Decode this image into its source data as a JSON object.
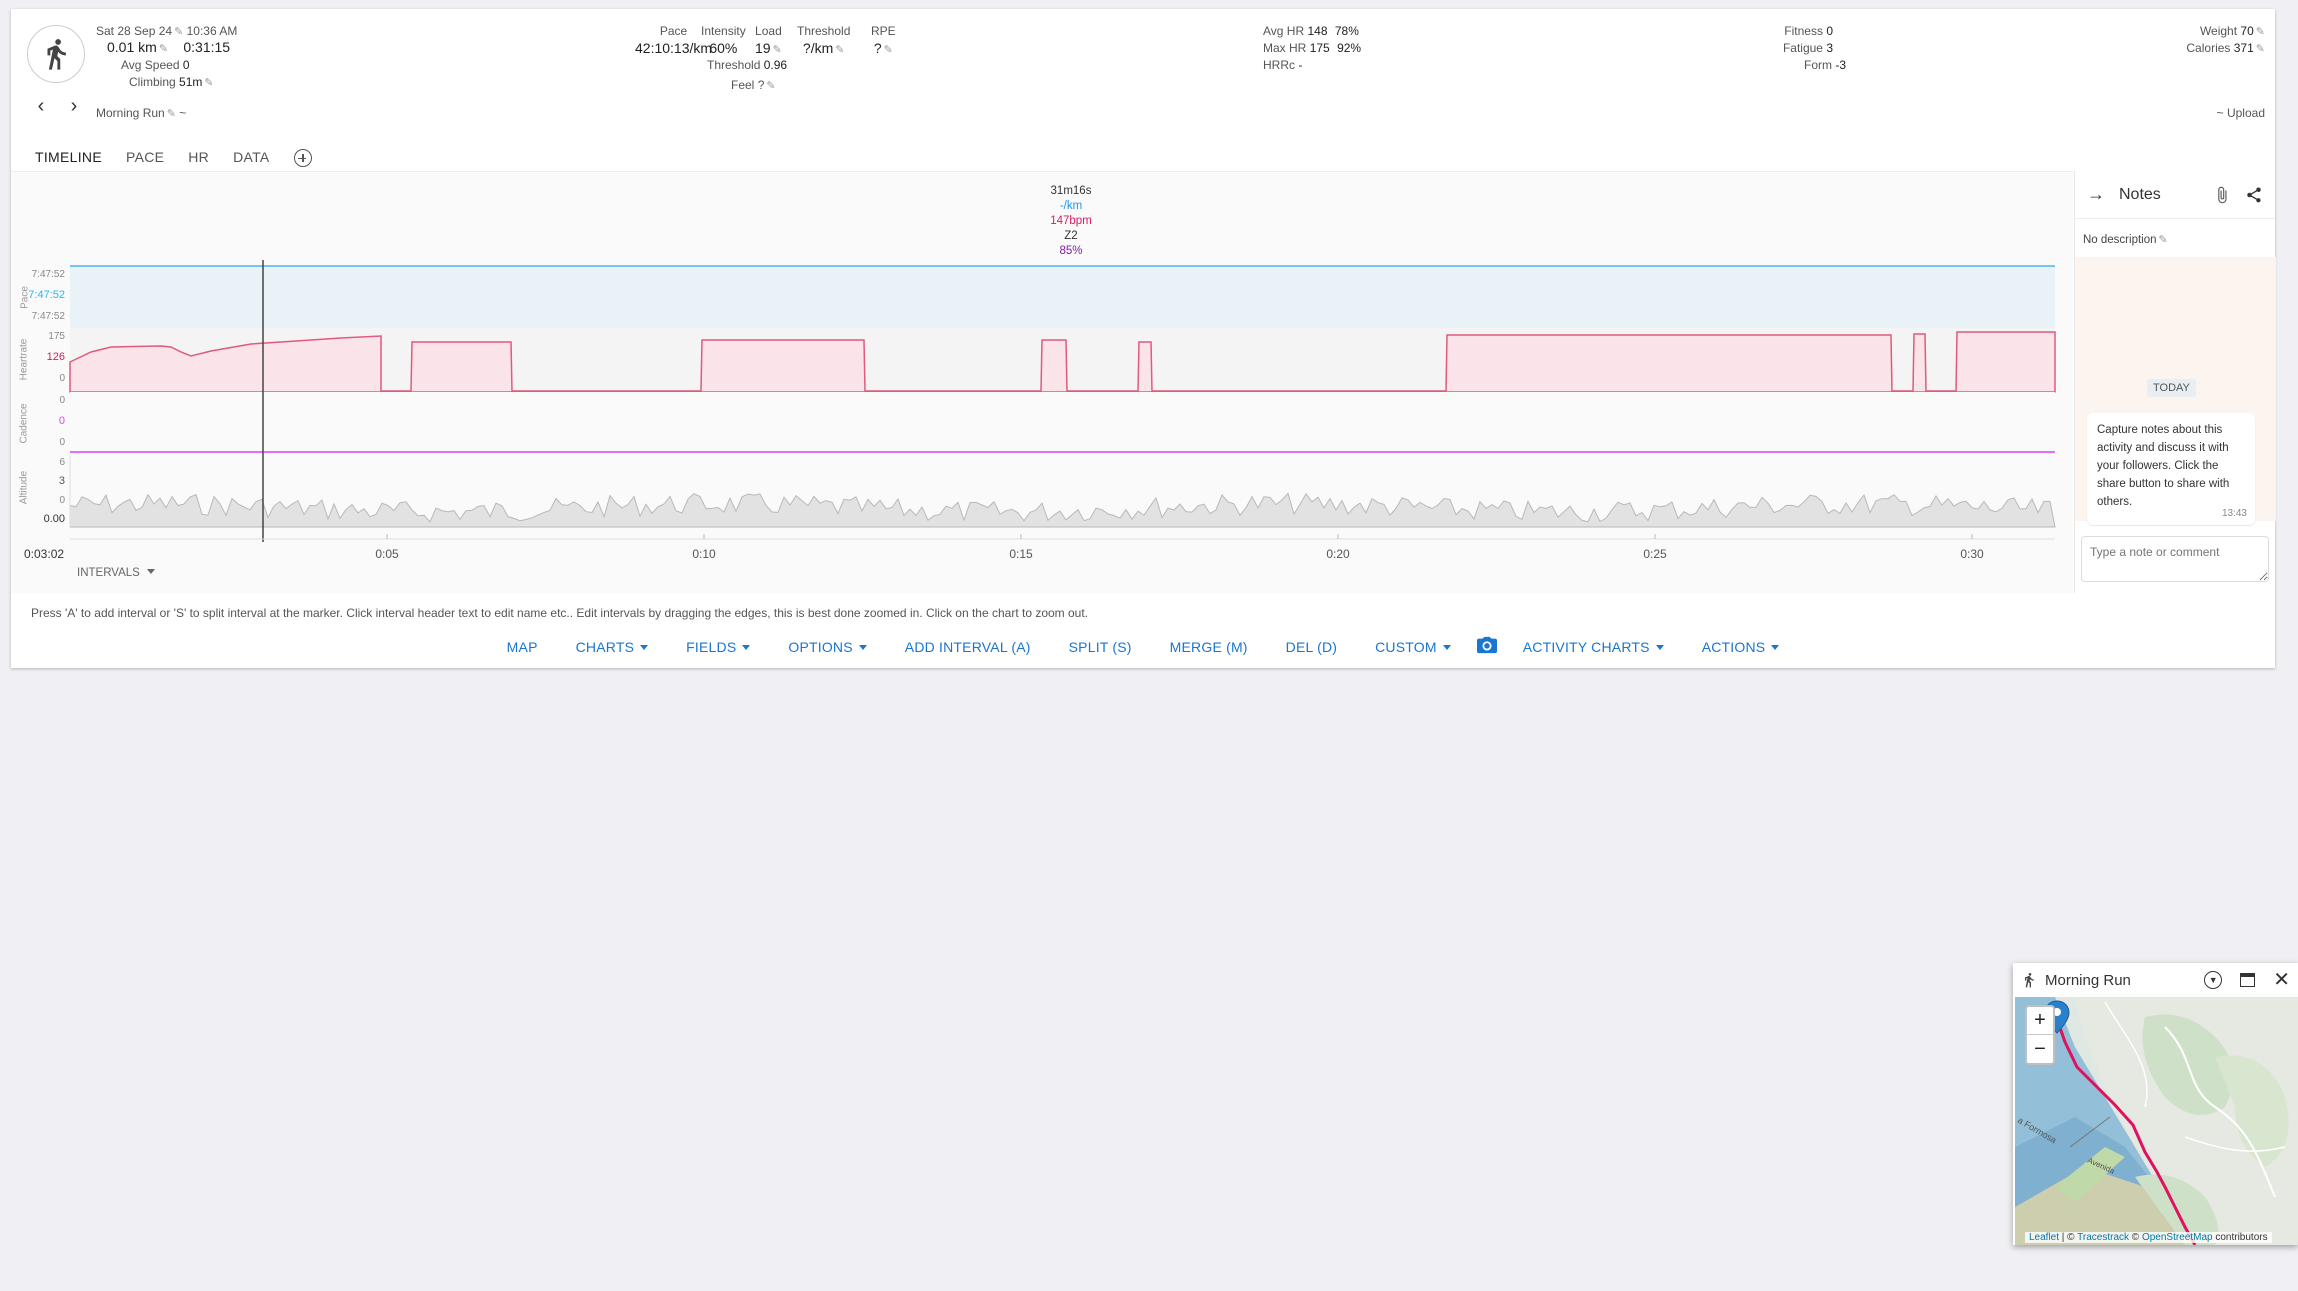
{
  "header": {
    "date": "Sat 28 Sep 24",
    "time": "10:36 AM",
    "distance": "0.01 km",
    "duration": "0:31:15",
    "avg_speed_label": "Avg Speed",
    "avg_speed": "0",
    "climbing_label": "Climbing",
    "climbing": "51m",
    "name": "Morning Run",
    "name_suffix": "~",
    "pace_label": "Pace",
    "pace": "42:10:13/km",
    "intensity_label": "Intensity",
    "intensity": "60%",
    "load_label": "Load",
    "load": "19",
    "threshold_label": "Threshold",
    "threshold": "?/km",
    "rpe_label": "RPE",
    "rpe": "?",
    "threshold2_label": "Threshold",
    "threshold2": "0.96",
    "feel_label": "Feel",
    "feel": "?",
    "avg_hr_label": "Avg HR",
    "avg_hr": "148",
    "avg_hr_pct": "78%",
    "max_hr_label": "Max HR",
    "max_hr": "175",
    "max_hr_pct": "92%",
    "hrrc_label": "HRRc",
    "hrrc": "-",
    "fitness_label": "Fitness",
    "fitness": "0",
    "fatigue_label": "Fatigue",
    "fatigue": "3",
    "form_label": "Form",
    "form": "-3",
    "weight_label": "Weight",
    "weight": "70",
    "calories_label": "Calories",
    "calories": "371",
    "upload": "~ Upload"
  },
  "tabs": [
    "TIMELINE",
    "PACE",
    "HR",
    "DATA"
  ],
  "cursor_info": {
    "duration": "31m16s",
    "pace": "-/km",
    "hr": "147bpm",
    "zone": "Z2",
    "pct": "85%"
  },
  "tracks": {
    "pace": {
      "label": "Pace",
      "top": "7:47:52",
      "mid": "7:47:52",
      "bot": "7:47:52"
    },
    "heartrate": {
      "label": "Heartrate",
      "top": "175",
      "mid": "126",
      "bot": "0"
    },
    "cadence": {
      "label": "Cadence",
      "top": "0",
      "mid": "0",
      "bot": "0"
    },
    "altitude": {
      "label": "Altitude",
      "top": "6",
      "mid": "3",
      "bot": "0",
      "base": "0.00"
    }
  },
  "time_axis": {
    "start": "0:03:02",
    "ticks": [
      "0:05",
      "0:10",
      "0:15",
      "0:20",
      "0:25",
      "0:30"
    ]
  },
  "intervals_label": "INTERVALS",
  "help_text": "Press 'A' to add interval or 'S' to split interval at the marker. Click interval header text to edit name etc.. Edit intervals by dragging the edges, this is best done zoomed in. Click on the chart to zoom out.",
  "toolbar": {
    "map": "MAP",
    "charts": "CHARTS",
    "fields": "FIELDS",
    "options": "OPTIONS",
    "add_interval": "ADD INTERVAL (A)",
    "split": "SPLIT (S)",
    "merge": "MERGE (M)",
    "del": "DEL (D)",
    "custom": "CUSTOM",
    "activity_charts": "ACTIVITY CHARTS",
    "actions": "ACTIONS"
  },
  "notes": {
    "title": "Notes",
    "no_description": "No description",
    "today": "TODAY",
    "message": "Capture notes about this activity and discuss it with your followers. Click the share button to share with others.",
    "message_time": "13:43",
    "input_placeholder": "Type a note or comment"
  },
  "map_popup": {
    "title": "Morning Run",
    "zoom_in": "+",
    "zoom_out": "−",
    "attribution_leaflet": "Leaflet",
    "attribution_sep": " | © ",
    "attribution_tracestrack": "Tracestrack",
    "attribution_osm_prefix": " © ",
    "attribution_osm": "OpenStreetMap",
    "attribution_tail": " contributors",
    "street_label_1": "a Formosa",
    "street_label_2": "Avenida"
  },
  "colors": {
    "accent": "#1976d2",
    "hr": "#d81b60",
    "pace": "#29b6f6",
    "cadence": "#e040fb",
    "altitude": "#9e9e9e"
  }
}
